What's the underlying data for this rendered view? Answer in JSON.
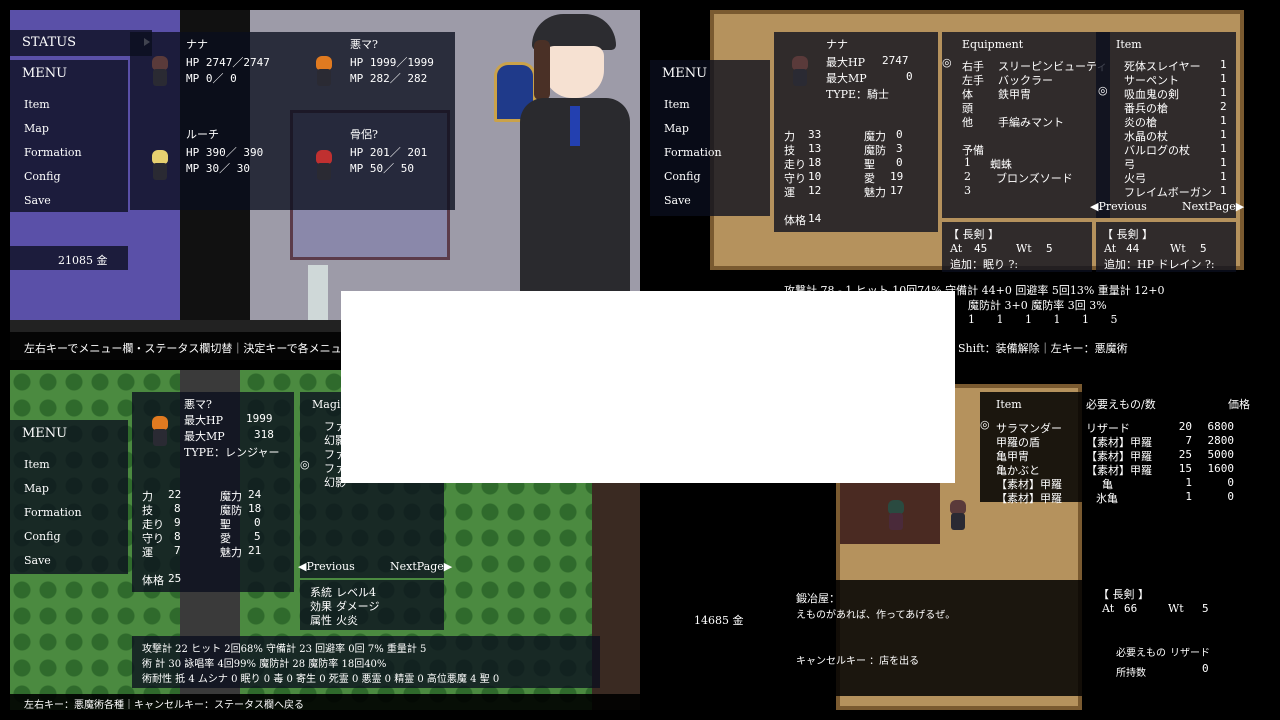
{
  "q1": {
    "status_label": "STATUS",
    "menu_title": "MENU",
    "menu": [
      "Item",
      "Map",
      "Formation",
      "Config",
      "Save"
    ],
    "gold": "21085 金",
    "party": [
      {
        "name": "ナナ",
        "hp": "HP  2747／2747",
        "mp": "MP     0／    0"
      },
      {
        "name": "悪マ?",
        "hp": "HP  1999／1999",
        "mp": "MP   282／ 282"
      },
      {
        "name": "ルーチ",
        "hp": "HP   390／ 390",
        "mp": "MP    30／   30"
      },
      {
        "name": "骨侶?",
        "hp": "HP   201／ 201",
        "mp": "MP    50／   50"
      }
    ],
    "help": "左右キーでメニュー欄・ステータス欄切替｜決定キーで各メニュー・キャラ"
  },
  "q2": {
    "menu_title": "MENU",
    "menu": [
      "Item",
      "Map",
      "Formation",
      "Config",
      "Save"
    ],
    "char_name": "ナナ",
    "max_hp_label": "最大HP",
    "max_hp": "2747",
    "max_mp_label": "最大MP",
    "max_mp": "0",
    "type": "TYPE：騎士",
    "stats": [
      [
        "力",
        "33",
        "魔力",
        "0"
      ],
      [
        "技",
        "13",
        "魔防",
        "3"
      ],
      [
        "走り",
        "18",
        "聖",
        "0"
      ],
      [
        "守り",
        "10",
        "愛",
        "19"
      ],
      [
        "運",
        "12",
        "魅力",
        "17"
      ]
    ],
    "kaku_label": "体格",
    "kaku": "14",
    "equip_title": "Equipment",
    "equip": [
      [
        "右手",
        "スリーピンビューティ"
      ],
      [
        "左手",
        "バックラー"
      ],
      [
        "体",
        "鉄甲冑"
      ],
      [
        "頭",
        ""
      ],
      [
        "他",
        "手編みマント"
      ]
    ],
    "reserve_label": "予備",
    "reserve": [
      [
        "1",
        "蜘蛛"
      ],
      [
        "2",
        "ブロンズソード"
      ],
      [
        "3",
        ""
      ]
    ],
    "item_title": "Item",
    "items": [
      [
        "死体スレイヤー",
        "1"
      ],
      [
        "サーペント",
        "1"
      ],
      [
        "吸血鬼の剣",
        "1"
      ],
      [
        "番兵の槍",
        "2"
      ],
      [
        "炎の槍",
        "1"
      ],
      [
        "水晶の杖",
        "1"
      ],
      [
        "バルログの杖",
        "1"
      ],
      [
        "弓",
        "1"
      ],
      [
        "火弓",
        "1"
      ],
      [
        "フレイムボーガン",
        "1"
      ]
    ],
    "prev": "◀Previous",
    "next": "NextPage▶",
    "wbox1_title": "【 長剣 】",
    "wbox1_at": "At",
    "wbox1_at_v": "45",
    "wbox1_wt": "Wt",
    "wbox1_wt_v": "5",
    "wbox1_extra": "追加：眠り ?:",
    "wbox2_title": "【 長剣 】",
    "wbox2_at": "At",
    "wbox2_at_v": "44",
    "wbox2_wt": "Wt",
    "wbox2_wt_v": "5",
    "wbox2_extra": "追加：HP ドレイン ?:",
    "bottom1": "攻撃計  78 - 1  ヒット 10回74%   守備計  44+0  回避率  5回13%   重量計 12+0",
    "bottom2": "魔防計   3+0  魔防率   3回  3%",
    "resist": "1    1    1    1    1    5",
    "help": "Shift：装備解除｜左キー：悪魔術"
  },
  "q3": {
    "menu_title": "MENU",
    "menu": [
      "Item",
      "Map",
      "Formation",
      "Config",
      "Save"
    ],
    "char_name": "悪マ?",
    "max_hp_label": "最大HP",
    "max_hp": "1999",
    "max_mp_label": "最大MP",
    "max_mp": "318",
    "type": "TYPE：レンジャー",
    "stats": [
      [
        "力",
        "22",
        "魔力",
        "24"
      ],
      [
        "技",
        "8",
        "魔防",
        "18"
      ],
      [
        "走り",
        "9",
        "聖",
        "0"
      ],
      [
        "守り",
        "8",
        "愛",
        "5"
      ],
      [
        "運",
        "7",
        "魅力",
        "21"
      ]
    ],
    "kaku_label": "体格",
    "kaku": "25",
    "magic_title": "Magic",
    "spells": [
      "ファ",
      "幻影",
      "ファ",
      "ファ",
      "幻影"
    ],
    "prev": "◀Previous",
    "next": "NextPage▶",
    "skill": [
      [
        "系統",
        "レベル4"
      ],
      [
        "効果",
        "ダメージ"
      ],
      [
        "属性",
        "火炎"
      ]
    ],
    "bottom1": "攻撃計  22    ヒット   2回68%    守備計  23     回避率   0回  7%     重量計  5",
    "bottom2": "術 計  30    詠唱率   4回99%    魔防計  28     魔防率  18回40%",
    "bottom3": "術耐性    抵  4 ムシナ  0  眠り  0  毒  0  寄生  0  死霊  0  悪霊  0  精霊  0  高位悪魔  4  聖  0",
    "help": "左右キー：悪魔術各種｜キャンセルキー：ステータス欄へ戻る"
  },
  "q4": {
    "gold": "14685 金",
    "item_title": "Item",
    "req_title": "必要えもの/数",
    "price_title": "価格",
    "rows": [
      [
        "サラマンダー",
        "リザード",
        "20",
        "6800"
      ],
      [
        "甲羅の盾",
        "【素材】甲羅",
        "7",
        "2800"
      ],
      [
        "亀甲冑",
        "【素材】甲羅",
        "25",
        "5000"
      ],
      [
        "亀かぶと",
        "【素材】甲羅",
        "15",
        "1600"
      ],
      [
        "【素材】甲羅",
        "亀",
        "1",
        "0"
      ],
      [
        "【素材】甲羅",
        "氷亀",
        "1",
        "0"
      ]
    ],
    "shop_name": "鍛冶屋：",
    "shop_msg": "えものがあれば、作ってあげるぜ。",
    "cancel": "キャンセルキー ：店を出る",
    "wbox_title": "【 長剣 】",
    "wbox_at": "At",
    "wbox_at_v": "66",
    "wbox_wt": "Wt",
    "wbox_wt_v": "5",
    "need_label": "必要えもの",
    "need_val": "リザード",
    "own_label": "所持数",
    "own_val": "0"
  }
}
